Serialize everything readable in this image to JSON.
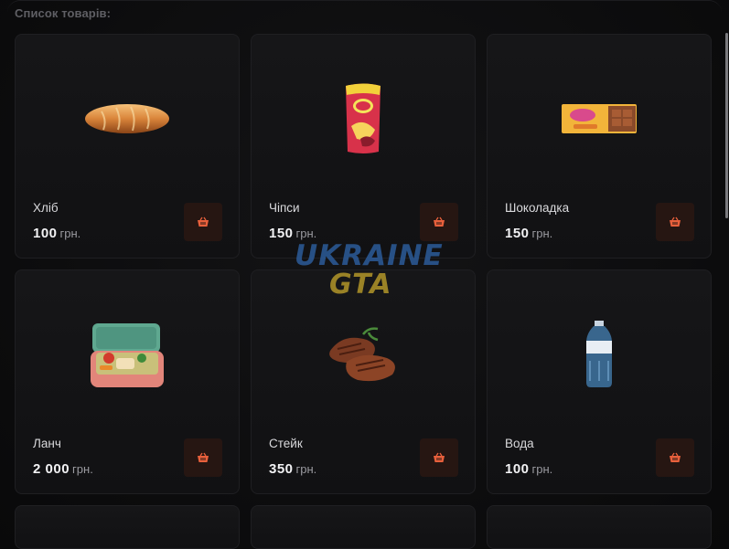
{
  "panel": {
    "title": "Список товарів:"
  },
  "colors": {
    "accent": "#e8603c",
    "button_bg": "#261612",
    "card_bg": "#141416",
    "page_bg": "#0b0b0c"
  },
  "products": [
    {
      "name": "Хліб",
      "price": "100",
      "currency": "грн.",
      "icon": "bread-icon"
    },
    {
      "name": "Чіпси",
      "price": "150",
      "currency": "грн.",
      "icon": "chips-icon"
    },
    {
      "name": "Шоколадка",
      "price": "150",
      "currency": "грн.",
      "icon": "chocolate-icon"
    },
    {
      "name": "Ланч",
      "price": "2 000",
      "currency": "грн.",
      "icon": "lunchbox-icon"
    },
    {
      "name": "Стейк",
      "price": "350",
      "currency": "грн.",
      "icon": "steak-icon"
    },
    {
      "name": "Вода",
      "price": "100",
      "currency": "грн.",
      "icon": "water-bottle-icon"
    }
  ],
  "watermark": {
    "line1": "UKRAINE",
    "line2": "GTA"
  }
}
